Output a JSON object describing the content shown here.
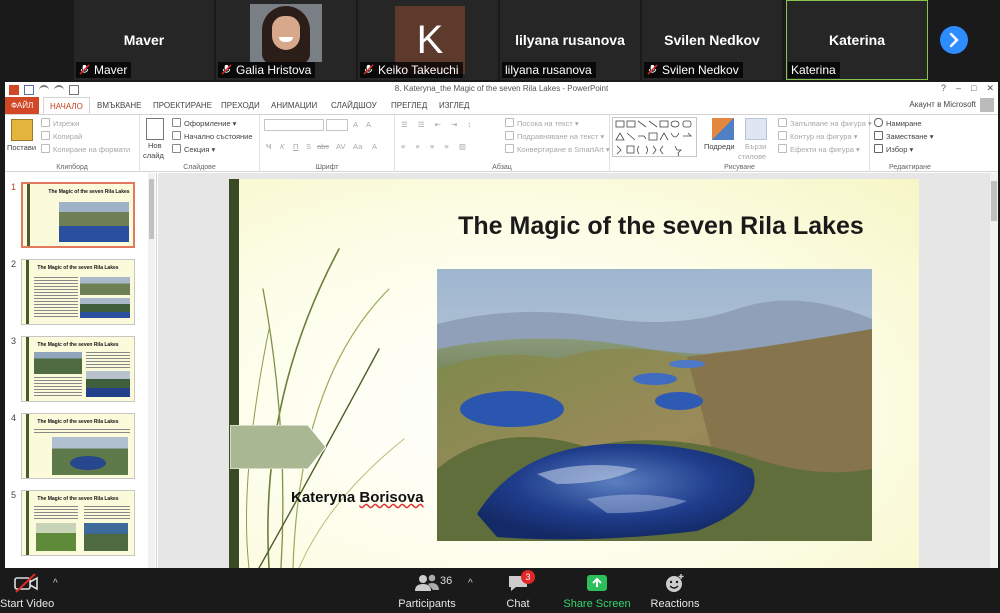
{
  "participants": [
    {
      "name": "Maver",
      "label": "Maver",
      "muted": true,
      "kind": "name"
    },
    {
      "name": "Galia Hristova",
      "label": "Galia Hristova",
      "muted": true,
      "kind": "photo"
    },
    {
      "name": "Keiko Takeuchi",
      "label": "Keiko Takeuchi",
      "muted": true,
      "kind": "avatar",
      "initial": "K"
    },
    {
      "name": "lilyana rusanova",
      "label": "lilyana rusanova",
      "muted": false,
      "kind": "name"
    },
    {
      "name": "Svilen Nedkov",
      "label": "Svilen Nedkov",
      "muted": true,
      "kind": "name"
    },
    {
      "name": "Katerina",
      "label": "Katerina",
      "muted": false,
      "kind": "name",
      "active": true
    }
  ],
  "powerpoint": {
    "doc_title": "8. Kateryna_the Magic of the seven Rila Lakes - PowerPoint",
    "account": "Акаунт в Microsoft",
    "tabs": [
      "ФАЙЛ",
      "НАЧАЛО",
      "ВМЪКВАНЕ",
      "ПРОЕКТИРАНЕ",
      "ПРЕХОДИ",
      "АНИМАЦИИ",
      "СЛАЙДШОУ",
      "ПРЕГЛЕД",
      "ИЗГЛЕД"
    ],
    "ribbon": {
      "clipboard": {
        "label": "Клипборд",
        "paste": "Постави",
        "cut": "Изрежи",
        "copy": "Копирай",
        "format_painter": "Копиране на формати"
      },
      "slides": {
        "label": "Слайдове",
        "new_slide_1": "Нов",
        "new_slide_2": "слайд",
        "layout": "Оформление",
        "reset": "Начално състояние",
        "section": "Секция"
      },
      "font": {
        "label": "Шрифт",
        "bold": "Ч",
        "italic": "К",
        "underline": "П",
        "strike": "S",
        "abc": "abc",
        "av": "AV",
        "aa": "Аа",
        "a": "А"
      },
      "paragraph": {
        "label": "Абзац",
        "text_direction": "Посока на текст",
        "align_text": "Подравняване на текст",
        "smartart": "Конвертиране в SmartArt"
      },
      "drawing": {
        "label": "Рисуване",
        "arrange": "Подреди",
        "quick_styles_1": "Бързи",
        "quick_styles_2": "стилове",
        "fill": "Запълване на фигура",
        "outline": "Контур на фигура",
        "effects": "Ефекти на фигура"
      },
      "editing": {
        "label": "Редактиране",
        "find": "Намиране",
        "replace": "Заместване",
        "select": "Избор"
      }
    },
    "slides_panel": [
      {
        "number": "1",
        "title": "The Magic of the seven Rila Lakes",
        "selected": true
      },
      {
        "number": "2",
        "title": "The Magic of the seven Rila Lakes"
      },
      {
        "number": "3",
        "title": "The Magic of the seven Rila Lakes"
      },
      {
        "number": "4",
        "title": "The Magic of the seven Rila Lakes"
      },
      {
        "number": "5",
        "title": "The Magic of the seven Rila Lakes"
      }
    ],
    "slide": {
      "title": "The Magic of the seven Rila Lakes",
      "author_first": "Kateryna",
      "author_last": "Borisova"
    }
  },
  "toolbar": {
    "start_video": "Start Video",
    "participants_label": "Participants",
    "participants_count": "36",
    "chat_label": "Chat",
    "chat_badge": "3",
    "share_label": "Share Screen",
    "reactions_label": "Reactions"
  },
  "colors": {
    "zoom_bg": "#1a1a1a",
    "share_green": "#38d46a",
    "ppt_accent": "#d24726",
    "active_speaker": "#8bc34a",
    "badge_red": "#e02828"
  }
}
